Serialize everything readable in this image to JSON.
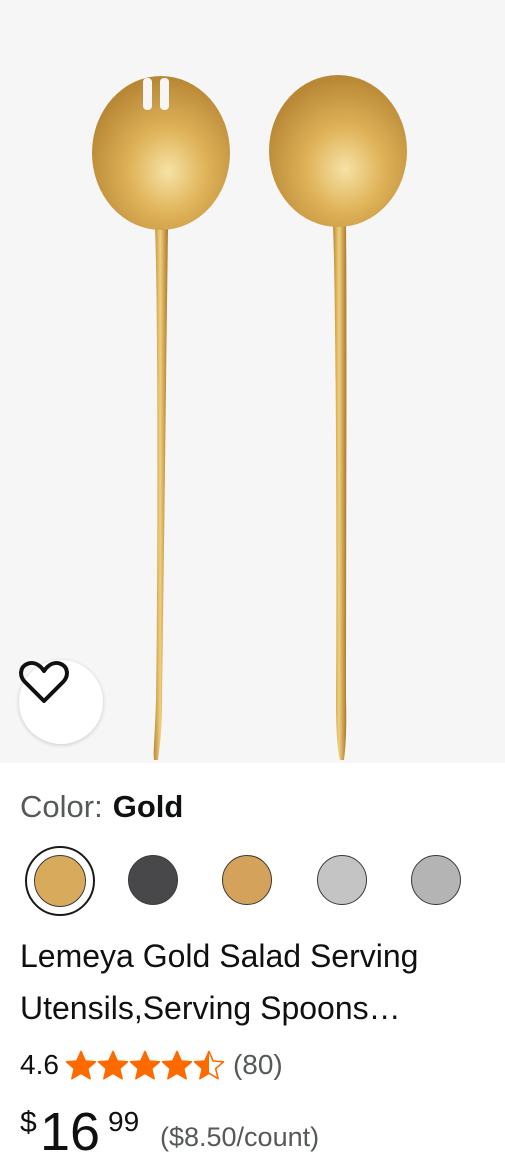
{
  "product": {
    "color_label": "Color:",
    "color_value": "Gold",
    "swatch_colors": [
      "#d8aa5c",
      "#48484a",
      "#d4a25a",
      "#c4c4c4",
      "#b4b4b4"
    ],
    "title": "Lemeya Gold Salad Serving Utensils,Serving Spoons…",
    "rating": {
      "value": "4.6",
      "stars": 4.5,
      "count": "(80)",
      "star_color": "#ff6a00"
    },
    "price": {
      "symbol": "$",
      "whole": "16",
      "fraction": "99",
      "unit": "($8.50/count)"
    }
  },
  "icons": {
    "wishlist": "heart-outline-icon"
  }
}
